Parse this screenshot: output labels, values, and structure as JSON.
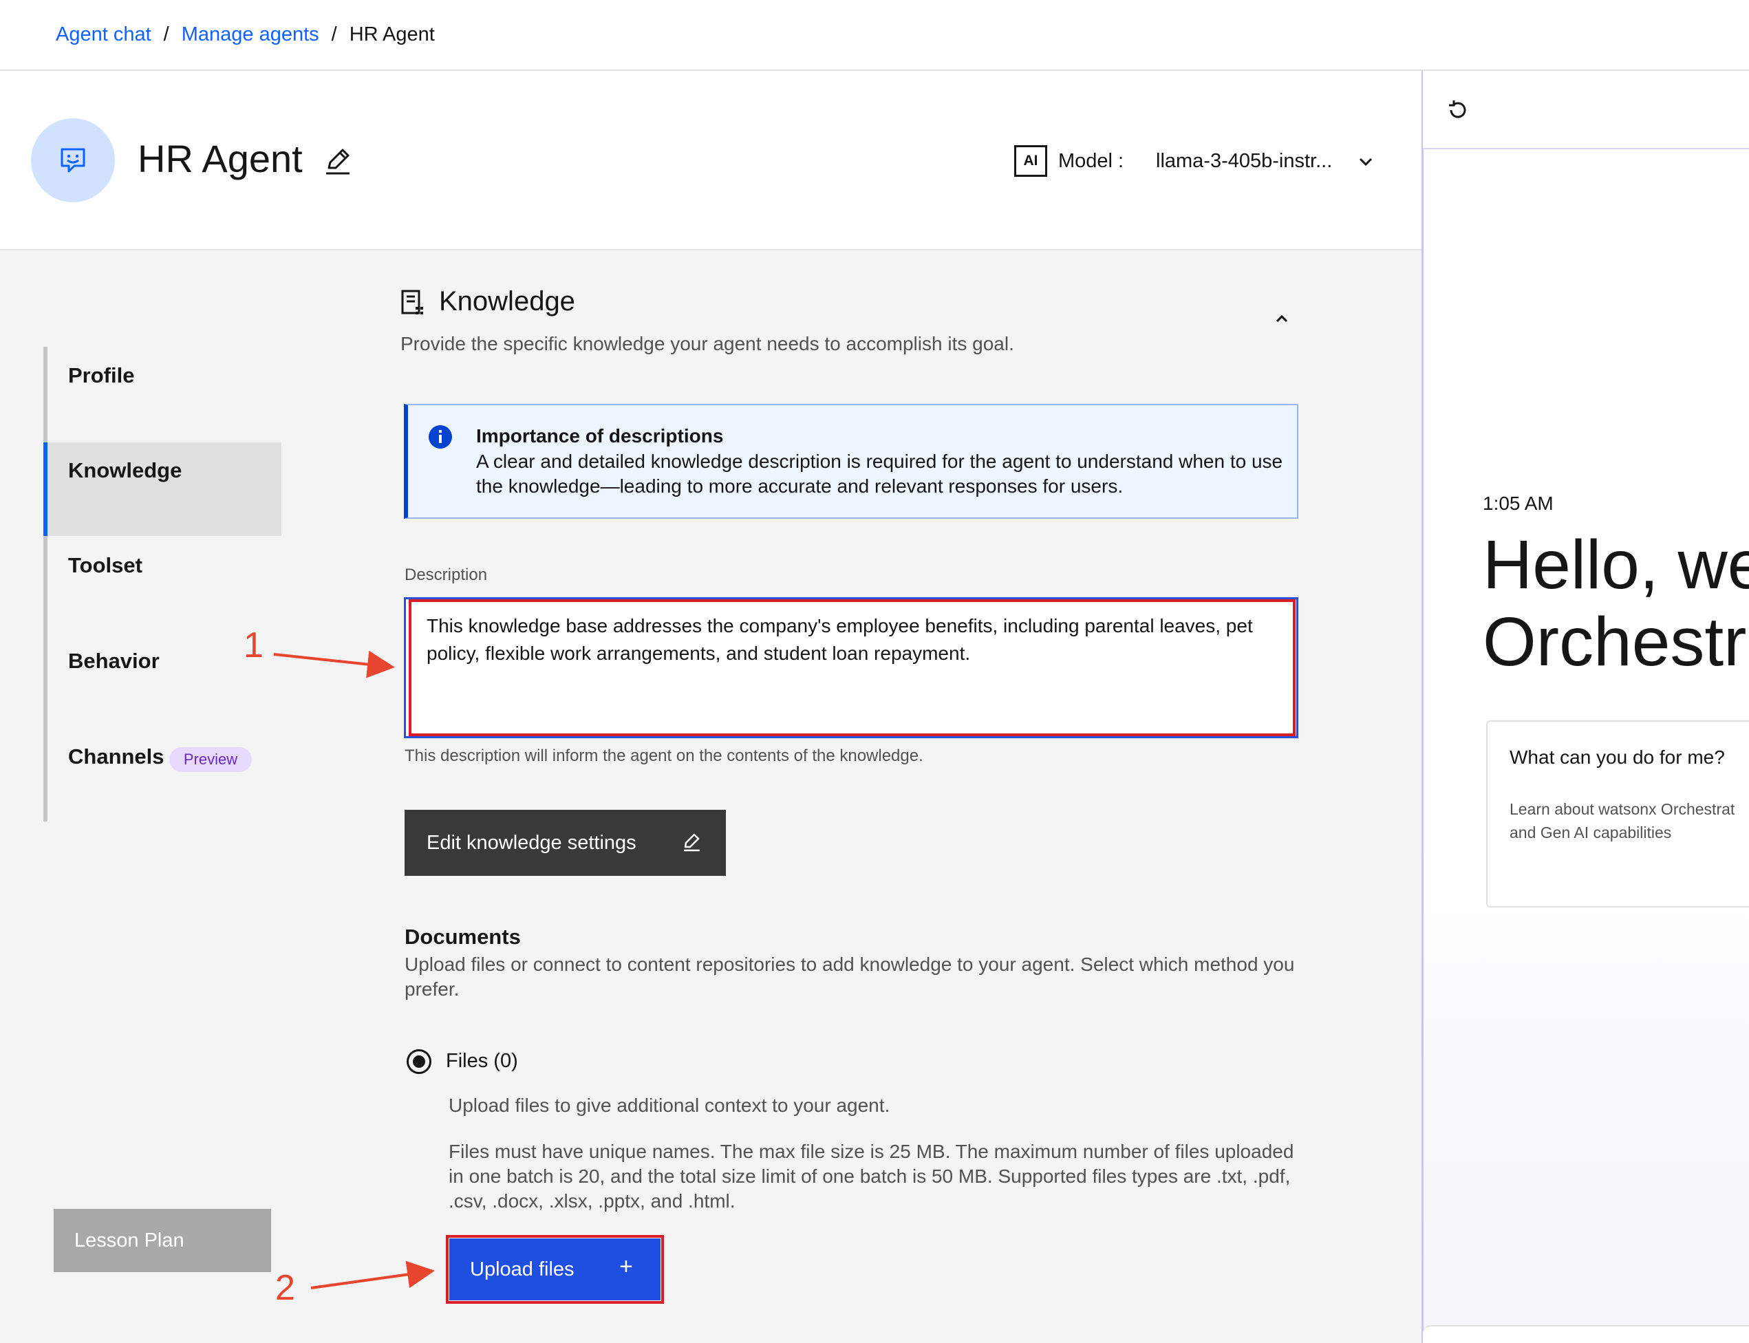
{
  "breadcrumb": {
    "items": [
      "Agent chat",
      "Manage agents",
      "HR Agent"
    ],
    "separator": "/"
  },
  "header": {
    "agent_name": "HR Agent",
    "ai_badge": "AI",
    "model_label": "Model :",
    "model_value": "llama-3-405b-instr..."
  },
  "nav": {
    "items": [
      "Profile",
      "Knowledge",
      "Toolset",
      "Behavior",
      "Channels"
    ],
    "preview_tag": "Preview",
    "active": "Knowledge"
  },
  "lesson_plan": "Lesson Plan",
  "knowledge": {
    "title": "Knowledge",
    "subtitle": "Provide the specific knowledge your agent needs to accomplish its goal.",
    "notice_title": "Importance of descriptions",
    "notice_body": "A clear and detailed knowledge description is required for the agent to understand when to use the knowledge—leading to more accurate and relevant responses for users.",
    "description_label": "Description",
    "description_value": "This knowledge base addresses the company's employee benefits, including parental leaves, pet policy, flexible work arrangements, and student loan repayment.",
    "description_helper": "This description will inform the agent on the contents of the knowledge.",
    "edit_settings_label": "Edit knowledge settings"
  },
  "documents": {
    "title": "Documents",
    "subtitle": "Upload files or connect to content repositories to add knowledge to your agent. Select which method you prefer.",
    "files_option": "Files (0)",
    "files_hint": "Upload files to give additional context to your agent.",
    "files_rules": "Files must have unique names. The max file size is 25 MB. The maximum number of files uploaded in one batch is 20, and the total size limit of one batch is 50 MB. Supported files types are .txt, .pdf, .csv, .docx, .xlsx, .pptx, and .html.",
    "upload_label": "Upload files",
    "upload_plus": "+"
  },
  "chat_preview": {
    "time": "1:05 AM",
    "greeting_line1": "Hello, we",
    "greeting_line2": "Orchestra",
    "card_title": "What can you do for me?",
    "card_desc_line1": "Learn about watsonx Orchestrat",
    "card_desc_line2": "and Gen AI capabilities"
  },
  "annotations": {
    "step1": "1",
    "step2": "2"
  },
  "colors": {
    "accent": "#0f62fe",
    "highlight": "#da1e28",
    "annotation": "#e8452f"
  }
}
